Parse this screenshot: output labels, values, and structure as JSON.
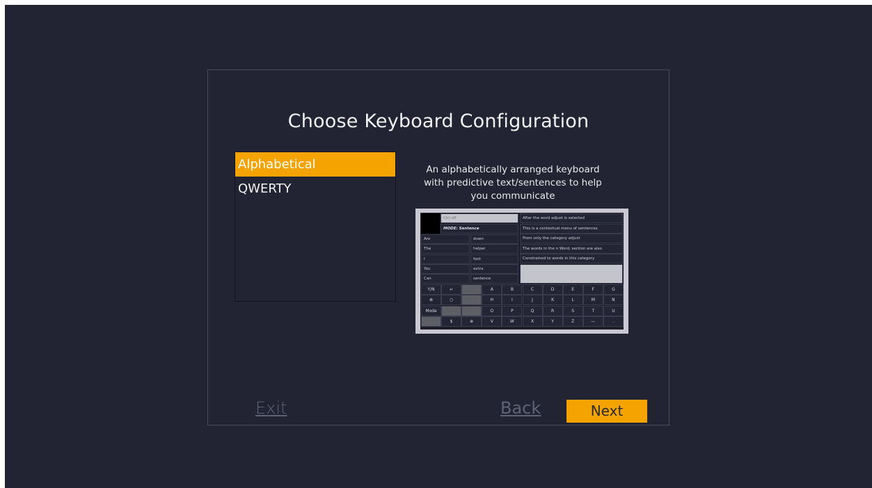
{
  "title": "Choose Keyboard Configuration",
  "options": [
    {
      "label": "Alphabetical",
      "selected": true
    },
    {
      "label": "QWERTY",
      "selected": false
    }
  ],
  "description": "An alphabetically arranged keyboard with predictive text/sentences to help you communicate",
  "preview": {
    "ctrl": "Ctrl off",
    "mode": "MODE: Sentence",
    "sentences": [
      "After the word adjust is selected",
      "This is a contextual menu of sentences",
      "From only the category adjust",
      "The words in the n Word, section are also",
      "Constrained to words in this category"
    ],
    "col1": [
      "Are",
      "The",
      "I",
      "You",
      "Can"
    ],
    "col2": [
      "down",
      "helper",
      "foot",
      "extra",
      "sentence"
    ],
    "keys_row1": [
      "Y/N",
      "↵",
      "",
      "A",
      "B",
      "C",
      "D",
      "E",
      "F",
      "G"
    ],
    "keys_row2": [
      "⊗",
      "○",
      "",
      "H",
      "I",
      "J",
      "K",
      "L",
      "M",
      "N"
    ],
    "keys_row3": [
      "Mode",
      "",
      "",
      "O",
      "P",
      "Q",
      "R",
      "S",
      "T",
      "U"
    ],
    "keys_row4": [
      "",
      "$",
      "⊕",
      "V",
      "W",
      "X",
      "Y",
      "Z",
      "—",
      "."
    ]
  },
  "buttons": {
    "exit": "Exit",
    "back": "Back",
    "next": "Next"
  },
  "colors": {
    "accent": "#f5a300",
    "background": "#222433"
  }
}
